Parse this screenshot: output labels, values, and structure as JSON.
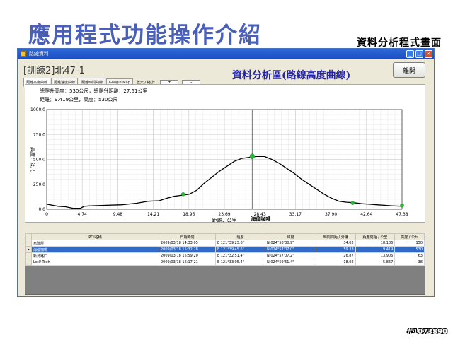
{
  "slide": {
    "title": "應用程式功能操作介紹",
    "subtitle": "資料分析程式畫面",
    "watermark": "#1073890"
  },
  "window": {
    "title": "路線資料",
    "controls": [
      "_",
      "□",
      "×"
    ]
  },
  "header": {
    "route_title": "[訓練2]北47-1",
    "leave_button": "離開",
    "area_label": "資料分析區(路線高度曲線)"
  },
  "tabs": [
    {
      "label": "距離高度曲線",
      "active": true
    },
    {
      "label": "距離速度曲線",
      "active": false
    },
    {
      "label": "距離時間曲線",
      "active": false
    },
    {
      "label": "Google Map",
      "active": false
    }
  ],
  "zoom": {
    "label": "放大 / 縮小:",
    "plus": "+",
    "minus": "-"
  },
  "chart_info": {
    "line1": "總爬升高度：530公尺，總爬升距離：27.61公里",
    "line2": "距離：9.419公里，高度：530公尺"
  },
  "chart_data": {
    "type": "line",
    "xlabel": "距離．公里",
    "ylabel": "高度．公尺",
    "xlim": [
      0,
      47.38
    ],
    "ylim": [
      0,
      1000
    ],
    "x_ticks": [
      "0",
      "4.74",
      "9.48",
      "14.21",
      "18.95",
      "23.69",
      "28.43",
      "33.17",
      "37.90",
      "42.64",
      "47.38"
    ],
    "y_ticks": [
      "0.0",
      "250.0",
      "500.0",
      "750.0",
      "1000.0"
    ],
    "grid": true,
    "cursor": {
      "x": 27.4,
      "label": "海倫咖啡"
    },
    "series": [
      {
        "x": [
          0,
          1.5,
          2.5,
          3.5,
          4.5,
          5.0,
          6.0,
          8.0,
          10.0,
          12.0,
          13.5,
          15.0,
          16.0,
          17.0,
          18.0,
          19.0,
          20.0,
          21.0,
          22.0,
          23.0,
          24.0,
          25.0,
          26.0,
          27.0,
          27.4,
          28.0,
          29.0,
          30.0,
          31.0,
          32.0,
          33.0,
          34.0,
          35.0,
          36.0,
          37.0,
          38.0,
          39.0,
          40.0,
          41.0,
          42.0,
          43.0,
          44.0,
          45.0,
          46.0,
          47.38
        ],
        "y": [
          50,
          30,
          25,
          10,
          10,
          30,
          35,
          40,
          45,
          60,
          80,
          85,
          110,
          130,
          140,
          150,
          190,
          260,
          320,
          380,
          430,
          480,
          510,
          520,
          525,
          530,
          530,
          500,
          460,
          410,
          360,
          300,
          250,
          200,
          150,
          110,
          80,
          70,
          65,
          55,
          50,
          45,
          40,
          35,
          30
        ]
      }
    ],
    "poi_markers": [
      {
        "x": 18.19,
        "y": 150
      },
      {
        "x": 27.4,
        "y": 530
      },
      {
        "x": 40.8,
        "y": 63
      },
      {
        "x": 47.38,
        "y": 38
      }
    ]
  },
  "table": {
    "columns": [
      "POI名稱",
      "日期時間",
      "經度",
      "緯度",
      "時間間距 / 分鐘",
      "距離間距 / 公里",
      "高度 / 公尺"
    ],
    "rows": [
      {
        "selected": false,
        "cells": [
          "烏建屋",
          "2009/03/18 14:33:05",
          "E 121°39'25.6\"",
          "N 024°58'30.9\"",
          "34.02",
          "18.186",
          "150"
        ]
      },
      {
        "selected": true,
        "cells": [
          "海倫咖啡",
          "2009/03/18 15:32:28",
          "E 121°39'45.6\"",
          "N 024°57'07.0\"",
          "59.38",
          "9.419",
          "530"
        ]
      },
      {
        "selected": false,
        "cells": [
          "新烏路口",
          "2009/03/18 15:59:20",
          "E 121°32'51.4\"",
          "N 024°57'07.2\"",
          "26.87",
          "13.906",
          "63"
        ]
      },
      {
        "selected": false,
        "cells": [
          "Lotlf Tech",
          "2009/03/18 16:17:21",
          "E 121°33'05.4\"",
          "N 024°59'51.4\"",
          "18.02",
          "5.867",
          "38"
        ]
      }
    ]
  },
  "colors": {
    "title": "#4a5fb8",
    "area_label": "#2424a8",
    "line": "#000000",
    "marker": "#22bb33",
    "selection": "#3169c6"
  }
}
